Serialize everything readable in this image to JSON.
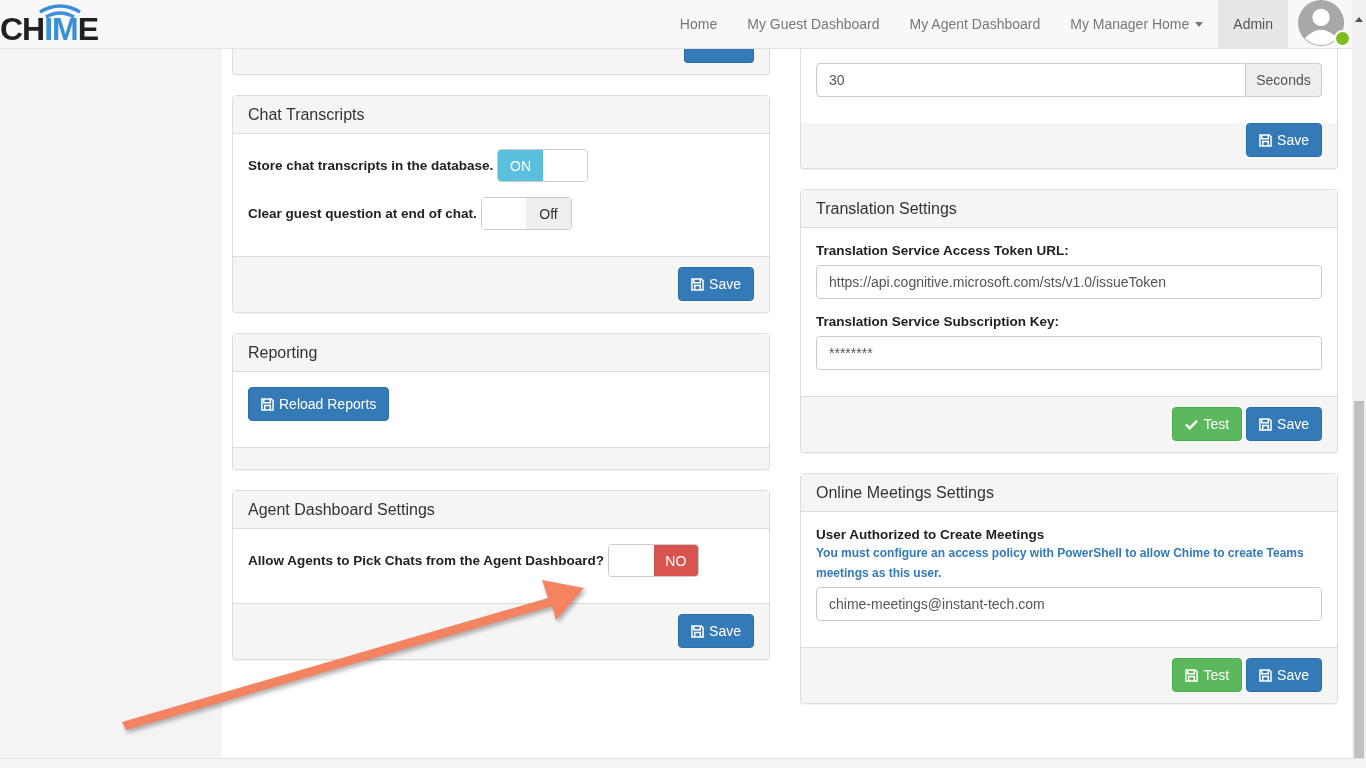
{
  "navbar": {
    "logo": "CHIME",
    "items": [
      {
        "label": "Home",
        "selected": false,
        "dropdown": false
      },
      {
        "label": "My Guest Dashboard",
        "selected": false,
        "dropdown": false
      },
      {
        "label": "My Agent Dashboard",
        "selected": false,
        "dropdown": false
      },
      {
        "label": "My Manager Home",
        "selected": false,
        "dropdown": true
      },
      {
        "label": "Admin",
        "selected": true,
        "dropdown": false
      }
    ],
    "user": {
      "online": true
    }
  },
  "left_column": [
    {
      "kind": "fragment",
      "buttons": [
        {
          "kind": "save"
        }
      ]
    },
    {
      "kind": "card",
      "title": "Chat Transcripts",
      "toggles": [
        {
          "label": "Store chat transcripts in the database.",
          "on": true,
          "text": "ON",
          "kind": "on-off"
        },
        {
          "label": "Clear guest question at end of chat.",
          "on": false,
          "text": "Off",
          "kind": "on-off"
        }
      ],
      "buttons": [
        {
          "kind": "save",
          "label": "Save"
        }
      ]
    },
    {
      "kind": "card",
      "title": "Reporting",
      "body_buttons": [
        {
          "kind": "save",
          "label": "Reload Reports"
        }
      ]
    },
    {
      "kind": "card",
      "title": "Agent Dashboard Settings",
      "toggles": [
        {
          "label": "Allow Agents to Pick Chats from the Agent Dashboard?",
          "on": false,
          "text": "NO",
          "kind": "yes-no"
        }
      ],
      "buttons": [
        {
          "kind": "save",
          "label": "Save"
        }
      ]
    }
  ],
  "right_column": [
    {
      "kind": "fragment",
      "fields": [
        {
          "value": "30",
          "addon": "Seconds"
        }
      ],
      "buttons": [
        {
          "kind": "save",
          "label": "Save"
        }
      ]
    },
    {
      "kind": "card",
      "title": "Translation Settings",
      "fields": [
        {
          "label": "Translation Service Access Token URL:",
          "value": "https://api.cognitive.microsoft.com/sts/v1.0/issueToken"
        },
        {
          "label": "Translation Service Subscription Key:",
          "value": "********"
        }
      ],
      "buttons": [
        {
          "kind": "check",
          "label": "Test"
        },
        {
          "kind": "save",
          "label": "Save"
        }
      ]
    },
    {
      "kind": "card",
      "title": "Online Meetings Settings",
      "fields": [
        {
          "label": "User Authorized to Create Meetings",
          "help": "You must configure an access policy with PowerShell to allow Chime to create Teams meetings as this user.",
          "value": "chime-meetings@instant-tech.com"
        }
      ],
      "buttons": [
        {
          "kind": "test",
          "label": "Test"
        },
        {
          "kind": "save",
          "label": "Save"
        }
      ]
    }
  ]
}
